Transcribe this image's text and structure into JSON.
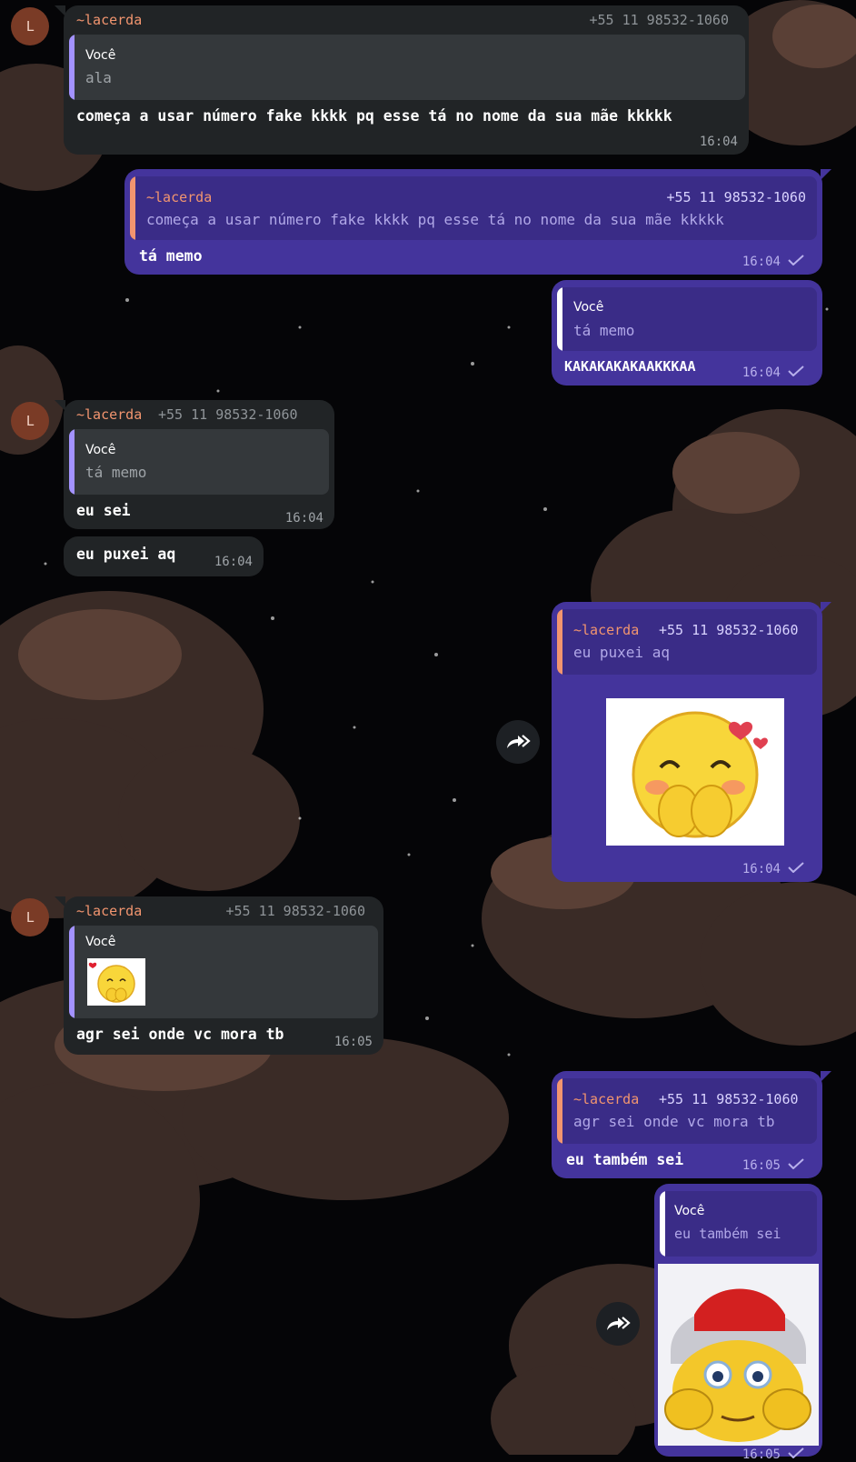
{
  "messages": {
    "m1": {
      "avatar": "L",
      "sender": "~lacerda",
      "phone": "+55 11 98532-1060",
      "reply_to": "Você",
      "reply_text": "ala",
      "text": "começa a usar número fake kkkk pq esse tá no nome da sua mãe kkkkk",
      "time": "16:04"
    },
    "m2": {
      "reply_to": "~lacerda",
      "reply_phone": "+55 11 98532-1060",
      "reply_text": "começa a usar número fake kkkk pq esse tá no nome da sua mãe kkkkk",
      "text": "tá memo",
      "time": "16:04"
    },
    "m3": {
      "reply_to": "Você",
      "reply_text": "tá memo",
      "text": "KAKAKAKAKAAKKKAA",
      "time": "16:04"
    },
    "m4": {
      "avatar": "L",
      "sender": "~lacerda",
      "phone": "+55 11 98532-1060",
      "reply_to": "Você",
      "reply_text": "tá memo",
      "text": "eu sei",
      "time": "16:04"
    },
    "m5": {
      "text": "eu puxei aq",
      "time": "16:04"
    },
    "m6": {
      "reply_to": "~lacerda",
      "reply_phone": "+55 11 98532-1060",
      "reply_text": "eu puxei aq",
      "sticker": "blushing-emoji-sticker",
      "time": "16:04"
    },
    "m7": {
      "avatar": "L",
      "sender": "~lacerda",
      "phone": "+55 11 98532-1060",
      "reply_to": "Você",
      "reply_sticker": "blushing-emoji-thumbnail",
      "text": "agr sei onde vc mora tb",
      "time": "16:05"
    },
    "m8": {
      "reply_to": "~lacerda",
      "reply_phone": "+55 11 98532-1060",
      "reply_text": "agr sei onde vc mora tb",
      "text": "eu também sei",
      "time": "16:05"
    },
    "m9": {
      "reply_to": "Você",
      "reply_text": "eu também sei",
      "sticker": "hat-emoji-sticker",
      "time": "16:05"
    }
  },
  "icons": {
    "forward": "share-arrow-icon",
    "read": "check-icon"
  },
  "colors": {
    "incoming": "#212426",
    "outgoing": "#44349c",
    "sender": "#f2956f"
  }
}
